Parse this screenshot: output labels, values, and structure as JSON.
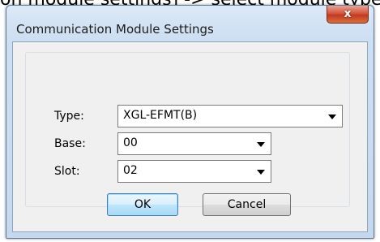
{
  "background_text": "on module settings] -> select module type",
  "window": {
    "title": "Communication Module Settings",
    "close_glyph": "x"
  },
  "form": {
    "type_label": "Type:",
    "type_value": "XGL-EFMT(B)",
    "base_label": "Base:",
    "base_value": "00",
    "slot_label": "Slot:",
    "slot_value": "02"
  },
  "buttons": {
    "ok": "OK",
    "cancel": "Cancel"
  },
  "icons": {
    "close": "close-icon",
    "dropdown": "chevron-down-icon"
  },
  "colors": {
    "title_bar": "#cddff2",
    "close_button": "#c4391f",
    "default_button_border": "#3c7fb1"
  }
}
